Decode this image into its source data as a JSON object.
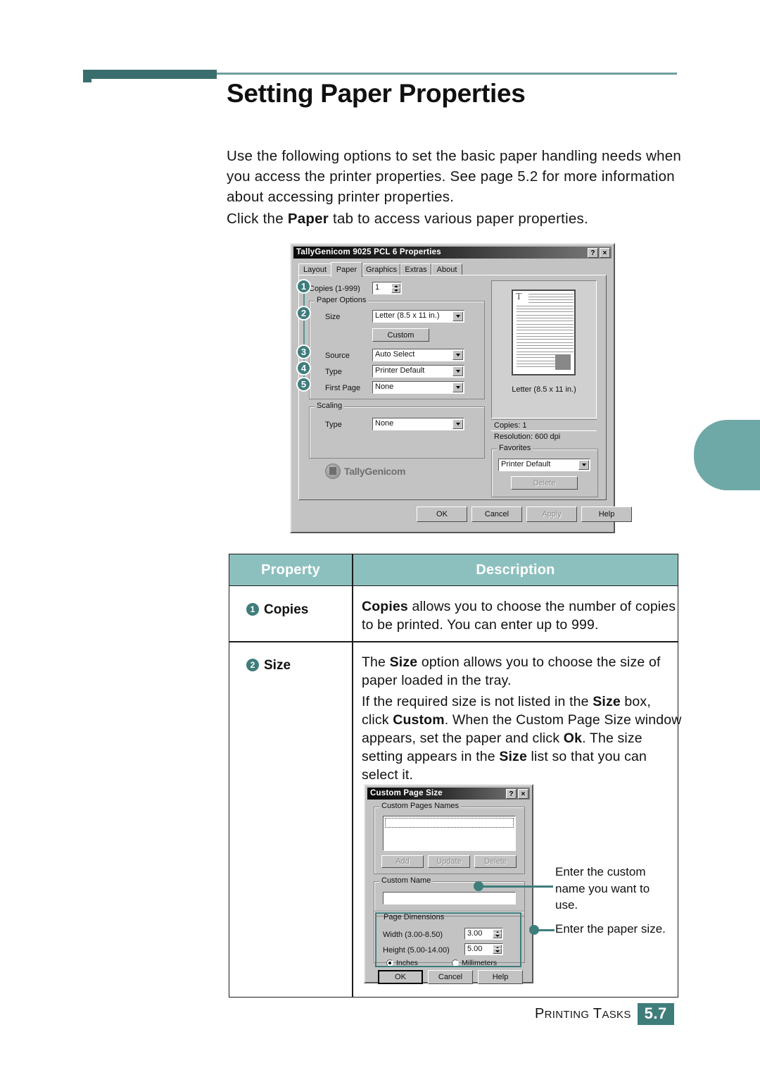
{
  "header": {
    "title": "Setting Paper Properties"
  },
  "intro": {
    "p1_a": "Use the following options to set the basic paper handling needs when you access the printer properties. See page 5.2 for more information about accessing printer properties.",
    "p2_a": "Click the ",
    "p2_b": "Paper",
    "p2_c": " tab to access various paper properties."
  },
  "printer_dialog": {
    "title": "TallyGenicom 9025 PCL 6 Properties",
    "help_btn": "?",
    "close_btn": "×",
    "tabs": [
      {
        "label": "Layout",
        "selected": false
      },
      {
        "label": "Paper",
        "selected": true
      },
      {
        "label": "Graphics",
        "selected": false
      },
      {
        "label": "Extras",
        "selected": false
      },
      {
        "label": "About",
        "selected": false
      }
    ],
    "copies_label": "Copies (1-999)",
    "copies_value": "1",
    "paper_options_label": "Paper Options",
    "size_label": "Size",
    "size_value": "Letter (8.5 x 11 in.)",
    "custom_button": "Custom",
    "source_label": "Source",
    "source_value": "Auto Select",
    "type_label": "Type",
    "type_value": "Printer Default",
    "first_page_label": "First Page",
    "first_page_value": "None",
    "scaling_label": "Scaling",
    "scaling_type_label": "Type",
    "scaling_type_value": "None",
    "preview_caption": "Letter (8.5 x 11 in.)",
    "preview_letter": "T",
    "status_copies": "Copies: 1",
    "status_resolution": "Resolution: 600 dpi",
    "favorites_label": "Favorites",
    "favorites_value": "Printer Default",
    "delete_button": "Delete",
    "brand": "TallyGenicom",
    "ok_button": "OK",
    "cancel_button": "Cancel",
    "apply_button": "Apply",
    "help_button": "Help",
    "callouts": [
      "1",
      "2",
      "3",
      "4",
      "5"
    ]
  },
  "table": {
    "col_property": "Property",
    "col_description": "Description",
    "rows": [
      {
        "num": "1",
        "property": "Copies",
        "desc_parts": [
          {
            "t": "Copies",
            "b": true
          },
          {
            "t": " allows you to choose the number of copies to be printed. You can enter up to 999.",
            "b": false
          }
        ]
      },
      {
        "num": "2",
        "property": "Size",
        "desc_parts": [
          {
            "t": "The ",
            "b": false
          },
          {
            "t": "Size",
            "b": true
          },
          {
            "t": " option allows you to choose the size of paper loaded in the tray.",
            "b": false
          }
        ]
      }
    ],
    "desc_extra_parts": [
      {
        "t": "If the required size is not listed in the ",
        "b": false
      },
      {
        "t": "Size",
        "b": true
      },
      {
        "t": " box, click ",
        "b": false
      },
      {
        "t": "Custom",
        "b": true
      },
      {
        "t": ". When the Custom Page Size window appears, set the paper and click ",
        "b": false
      },
      {
        "t": "Ok",
        "b": true
      },
      {
        "t": ". The size setting appears in the ",
        "b": false
      },
      {
        "t": "Size",
        "b": true
      },
      {
        "t": " list so that you can select it.",
        "b": false
      }
    ]
  },
  "custom_dialog": {
    "title": "Custom Page Size",
    "help_btn": "?",
    "close_btn": "×",
    "pages_names_label": "Custom Pages Names",
    "add_button": "Add",
    "update_button": "Update",
    "delete_button": "Delete",
    "custom_name_label": "Custom Name",
    "custom_name_value": "",
    "page_dimensions_label": "Page Dimensions",
    "width_label": "Width (3.00-8.50)",
    "width_value": "3.00",
    "height_label": "Height (5.00-14.00)",
    "height_value": "5.00",
    "unit_inches": "Inches",
    "unit_millimeters": "Millimeters",
    "unit_selected": "Inches",
    "ok_button": "OK",
    "cancel_button": "Cancel",
    "help_button": "Help"
  },
  "annotations": {
    "custom_name_note": "Enter the custom name you want to use.",
    "page_size_note": "Enter the paper size."
  },
  "footer": {
    "section_first": "P",
    "section_rest": "RINTING",
    "section2_first": "T",
    "section2_rest": "ASKS",
    "page_number": "5.7"
  },
  "colors": {
    "accent_dark": "#3f7d7b",
    "accent_mid": "#6fa9a7",
    "accent_light": "#8cc0be",
    "header_bar": "#3a6d6d"
  }
}
